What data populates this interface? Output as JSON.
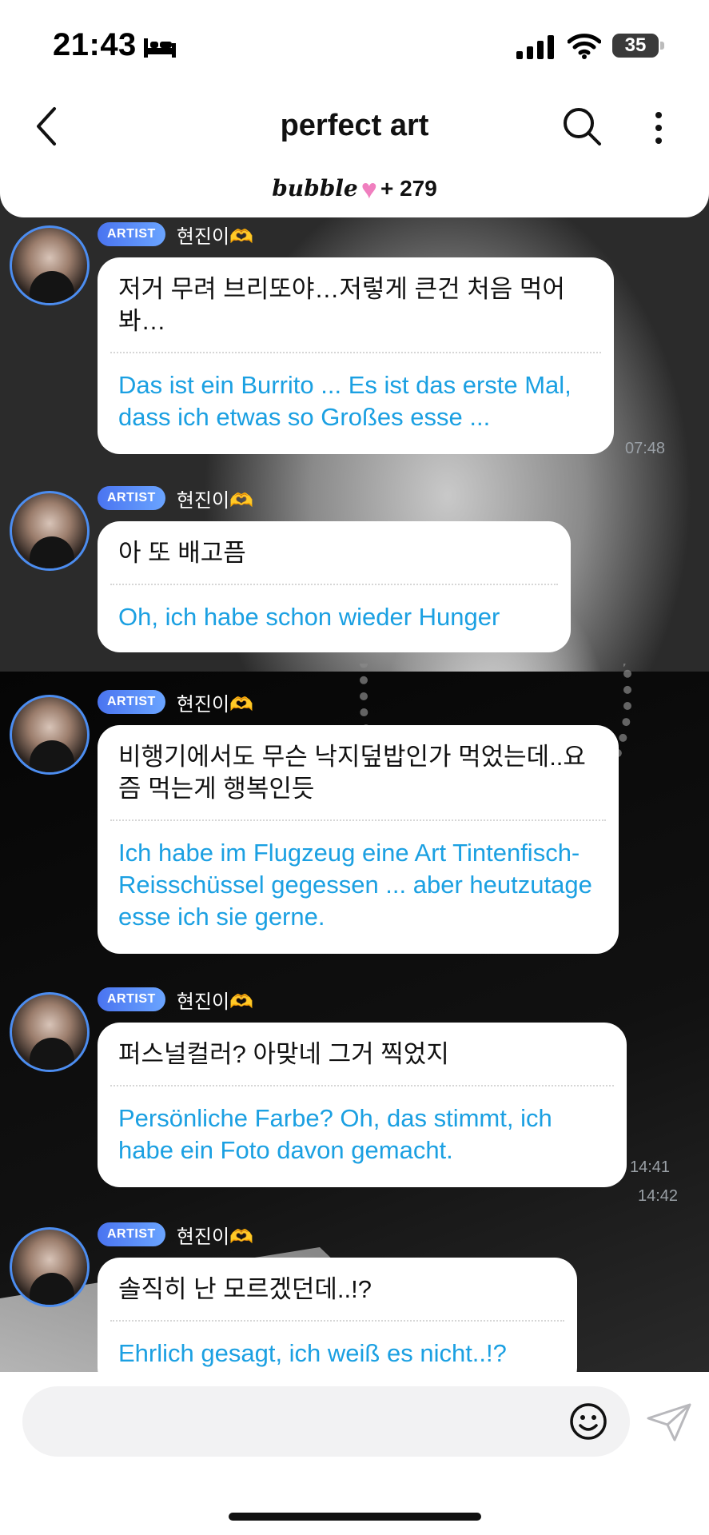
{
  "status_bar": {
    "time": "21:43",
    "battery": "35",
    "icons": [
      "bed-icon",
      "signal-icon",
      "wifi-icon",
      "battery-icon"
    ]
  },
  "header": {
    "title": "perfect art",
    "brand": "bubble",
    "subscriber_count": "+ 279"
  },
  "messages": [
    {
      "badge": "ARTIST",
      "sender": "현진이",
      "korean": "저거 무려 브리또야…저렇게 큰건 처음 먹어봐…",
      "translation": "Das ist ein Burrito ... Es ist das erste Mal, dass ich etwas so Großes esse ...",
      "time": "07:48"
    },
    {
      "badge": "ARTIST",
      "sender": "현진이",
      "korean": "아 또 배고픔",
      "translation": "Oh, ich habe schon wieder Hunger",
      "time": ""
    },
    {
      "badge": "ARTIST",
      "sender": "현진이",
      "korean": "비행기에서도 무슨 낙지덮밥인가 먹었는데..요즘 먹는게 행복인듯",
      "translation": "Ich habe im Flugzeug eine Art Tintenfisch-Reisschüssel gegessen ... aber heutzutage esse ich sie gerne.",
      "time": "14:41"
    },
    {
      "badge": "ARTIST",
      "sender": "현진이",
      "korean": "퍼스널컬러? 아맞네 그거 찍었지",
      "translation": "Persönliche Farbe? Oh, das stimmt, ich habe ein Foto davon gemacht.",
      "time": "14:42"
    },
    {
      "badge": "ARTIST",
      "sender": "현진이",
      "korean": "솔직히 난 모르겠던데..!?",
      "translation": "Ehrlich gesagt, ich weiß es nicht..!?",
      "time": ""
    }
  ],
  "colors": {
    "translation_text": "#1ba0e2",
    "artist_badge": "#4a74f0",
    "avatar_ring": "#4c8df0",
    "heart": "#f07fbf"
  }
}
